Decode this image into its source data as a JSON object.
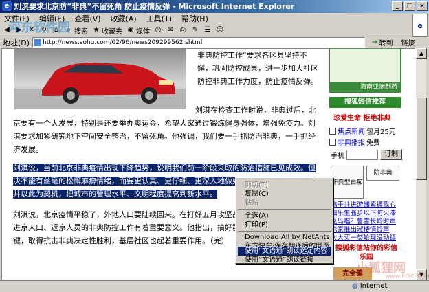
{
  "window": {
    "title": "刘淇要求北京防“非典”不留死角 防止疫情反弹 - Microsoft Internet Explorer",
    "controls": [
      "_",
      "□",
      "×"
    ],
    "throbber": "e"
  },
  "menu": [
    "文件(F)",
    "编辑(E)",
    "查看(V)",
    "收藏(A)",
    "工具(T)",
    "帮助(H)"
  ],
  "toolbar": {
    "search": "搜索",
    "favorites": "收藏夹",
    "media": "媒体"
  },
  "address": {
    "label": "地址(D)",
    "url": "http://news.sohu.com/02/96/news209299562.shtml",
    "go": "转到",
    "links": "链接"
  },
  "article": {
    "p1": "非典防控工作“要求各区县坚持不懈，巩固防控成果，进一步加大社区防控非典工作力度，防止疫情反弹。",
    "p2": "刘淇在检查工作时说，非典过后，北京要有一个大发展，特别是还要举办奥运会，希望大家通过锻炼健身强体，增强免疫力。刘淇要求加紧研究地下空间安全整治，不留死角。他强调，我们要一手抓防治非典，一手抓经济发展。",
    "p3": "刘淇说，当前北京非典疫情出现下降趋势，说明我们前一阶段采取的防治措施已见成效。但决不能有丝毫的松懈麻痹情绪，而要更认真、更仔细、更深入地做好防治非典工作。",
    "p3b": "工作，并以此为契机，把城市的管理水平、文明程度提高到新水平。",
    "p4": "刘淇说，北京疫情平稳了，外地人口要陆续回来。在打好五月攻坚战后，要进一步抓好外地进京人口、返京人员的非典防控工作有着重要意义。他指出，搞好群防群控是战胜非典的关键，取得抗击非典决定性胜利，基层社区也起着重要作用。（完）"
  },
  "sidebar": {
    "ad_caption": "海南亚洲制药",
    "sms_title": "搜狐短信推荐",
    "promo": "珍爱生命 拒绝非典",
    "options": [
      {
        "label": "焦点新闻",
        "price": "包月25元"
      },
      {
        "label": "非典播报",
        "price": "免费"
      }
    ],
    "phone_label": "手机",
    "order_button": "订制",
    "comic1": "非典型白痴",
    "comic2": "防非典",
    "links": [
      "搞于共进游储紧握我心",
      "独乐生骚步以下防火滞",
      "克鸟唱？鲁雪长岭时声",
      "琼家推出淑楼情铃声",
      "大大买一类轮现没动镇"
    ],
    "bottom_promo": "搜狐彩信站你的彩信乐园",
    "bottom_banner": "完全健"
  },
  "context_menu": {
    "items": [
      {
        "label": "剪切(T)",
        "state": "disabled"
      },
      {
        "label": "复制(C)",
        "state": "normal"
      },
      {
        "label": "粘贴",
        "state": "disabled"
      },
      {
        "label": "全选(A)",
        "state": "normal"
      },
      {
        "label": "打印(P)",
        "state": "normal"
      },
      {
        "label": "Download All by NetAnts",
        "state": "normal"
      },
      {
        "label": "东方快车·保存翻译后的网页",
        "state": "normal"
      },
      {
        "label": "使用“文语通”朗读选定内容",
        "state": "selected"
      },
      {
        "label": "使用“文语通”朗读链接",
        "state": "normal"
      }
    ]
  },
  "status": {
    "zone": "Internet"
  },
  "watermark": {
    "top": "河东软件园",
    "bottom": "小狐狸网",
    "bottom_url": "www.FOXPCS.COM"
  },
  "colors": {
    "title_bar": "#0a246a",
    "selection": "#0a246a",
    "sidebar_green": "#2e8b2e",
    "promo_red": "#c00000"
  }
}
